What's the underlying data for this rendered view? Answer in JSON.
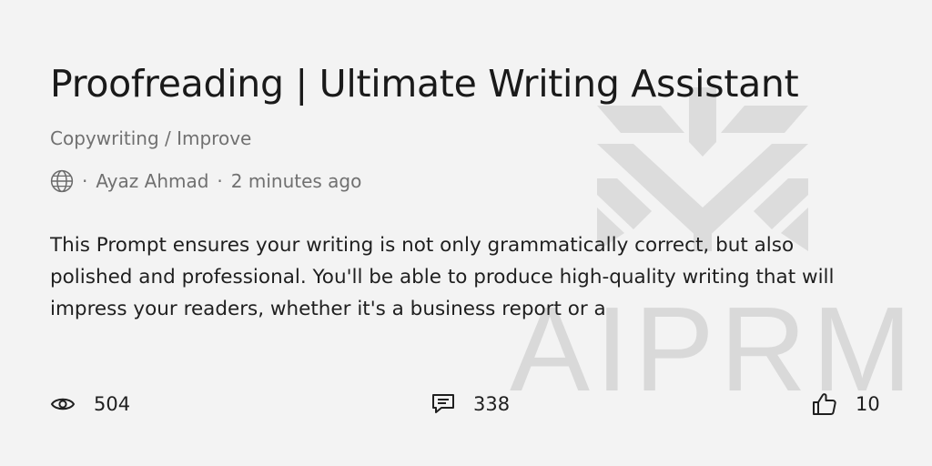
{
  "prompt": {
    "title": "Proofreading | Ultimate Writing Assistant",
    "breadcrumb": {
      "category": "Copywriting",
      "separator": " / ",
      "subcategory": "Improve"
    },
    "visibility_icon": "globe-icon",
    "author": "Ayaz Ahmad",
    "time_ago": "2 minutes ago",
    "description": "This Prompt ensures your writing is not only grammatically correct, but also polished and professional. You'll be able to produce high-quality writing that will impress your readers, whether it's a business report or a"
  },
  "stats": {
    "views": {
      "icon": "eye-icon",
      "count": "504"
    },
    "comments": {
      "icon": "comment-icon",
      "count": "338"
    },
    "likes": {
      "icon": "thumbs-up-icon",
      "count": "10"
    }
  },
  "watermark": {
    "text": "AIPRM",
    "color": "#d9d9d9"
  },
  "colors": {
    "background": "#f3f3f3",
    "text": "#1f1f1f",
    "muted": "#707070"
  }
}
